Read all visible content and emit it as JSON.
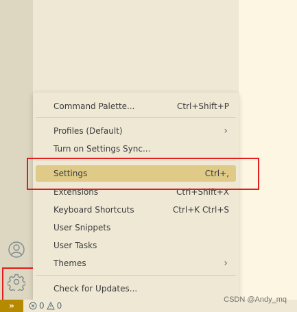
{
  "menu": {
    "items": [
      {
        "label": "Command Palette...",
        "shortcut": "Ctrl+Shift+P"
      },
      {
        "label": "Profiles (Default)",
        "shortcut": "",
        "submenu": true
      },
      {
        "label": "Turn on Settings Sync...",
        "shortcut": ""
      },
      {
        "label": "Settings",
        "shortcut": "Ctrl+,",
        "selected": true
      },
      {
        "label": "Extensions",
        "shortcut": "Ctrl+Shift+X"
      },
      {
        "label": "Keyboard Shortcuts",
        "shortcut": "Ctrl+K Ctrl+S"
      },
      {
        "label": "User Snippets",
        "shortcut": ""
      },
      {
        "label": "User Tasks",
        "shortcut": ""
      },
      {
        "label": "Themes",
        "shortcut": "",
        "submenu": true
      },
      {
        "label": "Check for Updates...",
        "shortcut": ""
      }
    ]
  },
  "status": {
    "remote_icon": "remote-icon",
    "errors": "0",
    "warnings": "0"
  },
  "watermark": "CSDN @Andy_mq",
  "colors": {
    "accent": "#b58900",
    "selection": "#dfca88",
    "highlight_box": "#e11d1d",
    "menu_bg": "#eee8d5",
    "editor_bg": "#fdf6e3"
  }
}
